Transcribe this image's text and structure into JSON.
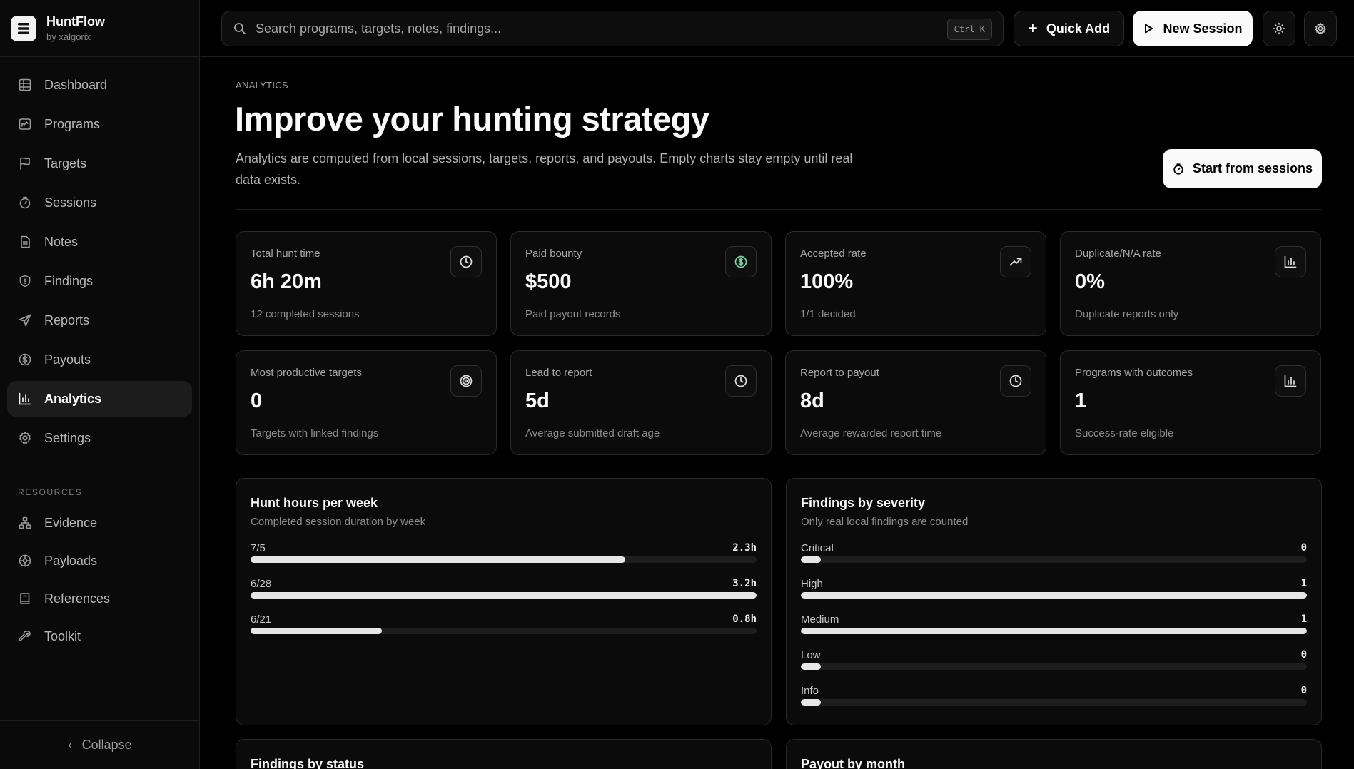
{
  "brand": {
    "name": "HuntFlow",
    "sub": "by xalgorix"
  },
  "nav": [
    {
      "label": "Dashboard",
      "icon": "dashboard-icon"
    },
    {
      "label": "Programs",
      "icon": "programs-icon"
    },
    {
      "label": "Targets",
      "icon": "flag-icon"
    },
    {
      "label": "Sessions",
      "icon": "timer-icon"
    },
    {
      "label": "Notes",
      "icon": "note-icon"
    },
    {
      "label": "Findings",
      "icon": "shield-icon"
    },
    {
      "label": "Reports",
      "icon": "send-icon"
    },
    {
      "label": "Payouts",
      "icon": "dollar-icon"
    },
    {
      "label": "Analytics",
      "icon": "bar-chart-icon",
      "active": true
    },
    {
      "label": "Settings",
      "icon": "gear-icon"
    }
  ],
  "resources": {
    "label": "RESOURCES",
    "items": [
      {
        "label": "Evidence",
        "icon": "evidence-icon"
      },
      {
        "label": "Payloads",
        "icon": "payloads-icon"
      },
      {
        "label": "References",
        "icon": "book-icon"
      },
      {
        "label": "Toolkit",
        "icon": "wrench-icon"
      }
    ]
  },
  "collapse_label": "Collapse",
  "topbar": {
    "search_placeholder": "Search programs, targets, notes, findings...",
    "shortcut": "Ctrl K",
    "quick_add": "Quick Add",
    "new_session": "New Session"
  },
  "header": {
    "eyebrow": "ANALYTICS",
    "title": "Improve your hunting strategy",
    "description": "Analytics are computed from local sessions, targets, reports, and payouts. Empty charts stay empty until real data exists.",
    "start_button": "Start from sessions"
  },
  "stats": [
    {
      "label": "Total hunt time",
      "value": "6h 20m",
      "sub": "12 completed sessions",
      "icon": "clock-icon"
    },
    {
      "label": "Paid bounty",
      "value": "$500",
      "sub": "Paid payout records",
      "icon": "dollar-icon"
    },
    {
      "label": "Accepted rate",
      "value": "100%",
      "sub": "1/1 decided",
      "icon": "trending-up-icon"
    },
    {
      "label": "Duplicate/N/A rate",
      "value": "0%",
      "sub": "Duplicate reports only",
      "icon": "bar-chart-icon"
    },
    {
      "label": "Most productive targets",
      "value": "0",
      "sub": "Targets with linked findings",
      "icon": "target-icon"
    },
    {
      "label": "Lead to report",
      "value": "5d",
      "sub": "Average submitted draft age",
      "icon": "clock-icon"
    },
    {
      "label": "Report to payout",
      "value": "8d",
      "sub": "Average rewarded report time",
      "icon": "clock-icon"
    },
    {
      "label": "Programs with outcomes",
      "value": "1",
      "sub": "Success-rate eligible",
      "icon": "bar-chart-icon"
    }
  ],
  "colors": {
    "accent_green": "#7fd6a6",
    "bar_fill": "#e6e6e6",
    "track": "#1e1e1e"
  },
  "hunt_hours": {
    "title": "Hunt hours per week",
    "subtitle": "Completed session duration by week",
    "rows": [
      {
        "label": "7/5",
        "value": "2.3h",
        "fraction": 0.74
      },
      {
        "label": "6/28",
        "value": "3.2h",
        "fraction": 1.0
      },
      {
        "label": "6/21",
        "value": "0.8h",
        "fraction": 0.26
      }
    ]
  },
  "severity": {
    "title": "Findings by severity",
    "subtitle": "Only real local findings are counted",
    "rows": [
      {
        "label": "Critical",
        "value": "0",
        "fraction": 0.04
      },
      {
        "label": "High",
        "value": "1",
        "fraction": 1.0
      },
      {
        "label": "Medium",
        "value": "1",
        "fraction": 1.0
      },
      {
        "label": "Low",
        "value": "0",
        "fraction": 0.04
      },
      {
        "label": "Info",
        "value": "0",
        "fraction": 0.04
      }
    ]
  },
  "bottom_panels": {
    "status_title": "Findings by status",
    "payout_title": "Payout by month"
  }
}
